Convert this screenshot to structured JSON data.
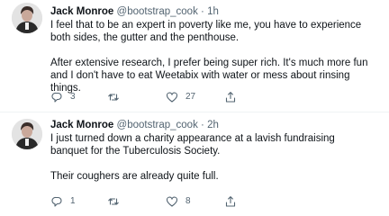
{
  "tweets": [
    {
      "name": "Jack Monroe",
      "handle": "@bootstrap_cook",
      "dot": "·",
      "time": "1h",
      "paragraphs": [
        "I feel that to be an expert in poverty like me, you have to experience both sides, the gutter and the penthouse.",
        "After extensive research, I prefer being super rich. It's much more fun and I don't have to eat Weetabix with water or mess about rinsing things."
      ],
      "actions": {
        "reply": "3",
        "retweet": "",
        "like": "27"
      }
    },
    {
      "name": "Jack Monroe",
      "handle": "@bootstrap_cook",
      "dot": "·",
      "time": "2h",
      "paragraphs": [
        "I just turned down a charity appearance at a lavish fundraising banquet for the Tuberculosis Society.",
        "Their coughers are already quite full."
      ],
      "actions": {
        "reply": "1",
        "retweet": "",
        "like": "8"
      }
    }
  ],
  "icons": {
    "reply": "reply-icon",
    "retweet": "retweet-icon",
    "like": "like-icon",
    "share": "share-icon"
  },
  "colors": {
    "text": "#0f1419",
    "muted": "#536471",
    "divider": "#eff3f4"
  }
}
